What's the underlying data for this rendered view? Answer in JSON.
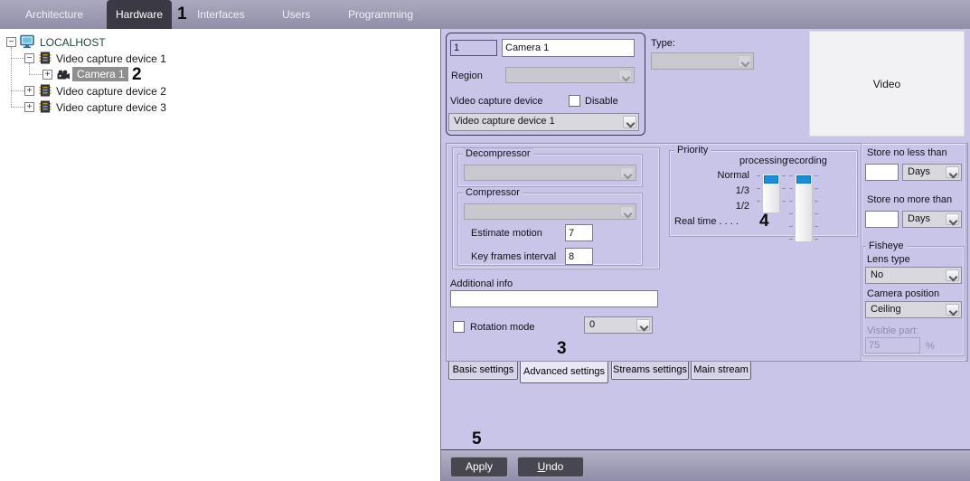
{
  "menu": {
    "items": [
      {
        "label": "Architecture",
        "active": false
      },
      {
        "label": "Hardware",
        "active": true
      },
      {
        "label": "Interfaces",
        "active": false
      },
      {
        "label": "Users",
        "active": false
      },
      {
        "label": "Programming",
        "active": false
      }
    ]
  },
  "annotations": {
    "n1": "1",
    "n2": "2",
    "n3": "3",
    "n4": "4",
    "n5": "5"
  },
  "tree": {
    "root": {
      "label": "LOCALHOST",
      "icon": "monitor-icon",
      "expanded": true
    },
    "items": [
      {
        "label": "Video capture device 1",
        "icon": "chip-icon",
        "expanded": true,
        "selected": false
      },
      {
        "label": "Camera 1",
        "icon": "camera-icon",
        "expanded": false,
        "selected": true
      },
      {
        "label": "Video capture device 2",
        "icon": "chip-icon",
        "expanded": false,
        "selected": false
      },
      {
        "label": "Video capture device 3",
        "icon": "chip-icon",
        "expanded": false,
        "selected": false
      }
    ]
  },
  "identity": {
    "id_value": "1",
    "name_value": "Camera 1",
    "region_label": "Region",
    "region_value": "",
    "device_label": "Video capture device",
    "disable_label": "Disable",
    "disable_checked": false,
    "device_value": "Video capture device 1"
  },
  "type_section": {
    "label": "Type:",
    "value": ""
  },
  "video_preview": {
    "label": "Video"
  },
  "codec": {
    "decompressor_label": "Decompressor",
    "decompressor_value": "",
    "compressor_label": "Compressor",
    "compressor_value": "",
    "estimate_motion_label": "Estimate motion",
    "estimate_motion_value": "7",
    "key_frames_label": "Key frames interval",
    "key_frames_value": "8"
  },
  "additional_info": {
    "label": "Additional info",
    "value": ""
  },
  "rotation": {
    "label": "Rotation mode",
    "checked": false,
    "value": "0"
  },
  "priority": {
    "label": "Priority",
    "columns": [
      "processing",
      "recording"
    ],
    "rows": [
      "Normal",
      "1/3",
      "1/2",
      "Real time . . . ."
    ],
    "processing_value": "Normal",
    "recording_value": "Normal"
  },
  "storage": {
    "min_label": "Store no less than",
    "min_value": "",
    "min_unit": "Days",
    "max_label": "Store no more than",
    "max_value": "",
    "max_unit": "Days"
  },
  "fisheye": {
    "label": "Fisheye",
    "lens_type_label": "Lens type",
    "lens_type_value": "No",
    "camera_position_label": "Camera position",
    "camera_position_value": "Ceiling",
    "visible_part_label": "Visible part:",
    "visible_part_value": "75",
    "visible_part_unit": "%"
  },
  "tabs": {
    "items": [
      "Basic settings",
      "Advanced settings",
      "Streams settings",
      "Main stream"
    ],
    "active": "Advanced settings"
  },
  "actions": {
    "apply": "Apply",
    "undo_accel": "U",
    "undo_rest": "ndo"
  }
}
